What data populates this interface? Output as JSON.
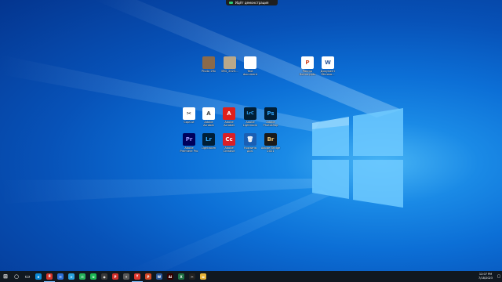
{
  "share_bar": {
    "text": "Идёт демонстрация"
  },
  "desktop_icons": [
    {
      "label": "Photo 2fix",
      "glyph": "",
      "bg": "#8a6a4a",
      "fg": "#fff"
    },
    {
      "label": "IMG_2023...",
      "glyph": "",
      "bg": "#b9a88a",
      "fg": "#fff"
    },
    {
      "label": "Text\ndocument",
      "glyph": "",
      "bg": "#ffffff",
      "fg": "#c00"
    },
    {
      "label": "Ponmo\nHolmo.pptx",
      "glyph": "P",
      "bg": "#ffffff",
      "fg": "#d24726"
    },
    {
      "label": "Документ\nMicroso...",
      "glyph": "W",
      "bg": "#ffffff",
      "fg": "#2b579a"
    },
    {
      "label": "CapCut",
      "glyph": "✂",
      "bg": "#ffffff",
      "fg": "#000"
    },
    {
      "label": "Adobe\nAcrobat",
      "glyph": "A",
      "bg": "#ffffff",
      "fg": "#444"
    },
    {
      "label": "Adobe\nAcrobat",
      "glyph": "A",
      "bg": "#e0201b",
      "fg": "#fff"
    },
    {
      "label": "Adobe\nLightroom",
      "glyph": "LrC",
      "bg": "#001e36",
      "fg": "#31a8ff"
    },
    {
      "label": "Adobe\nPhotoshop",
      "glyph": "Ps",
      "bg": "#001e36",
      "fg": "#31a8ff"
    },
    {
      "label": "Adobe\nPremiere Pro",
      "glyph": "Pr",
      "bg": "#00005b",
      "fg": "#9999ff"
    },
    {
      "label": "Lightroom",
      "glyph": "Lr",
      "bg": "#001e36",
      "fg": "#31a8ff"
    },
    {
      "label": "Adobe\nCreative",
      "glyph": "Cc",
      "bg": "#da1f26",
      "fg": "#fff"
    },
    {
      "label": "Корзина\nдоп.",
      "glyph": "🗑",
      "bg": "#1a5fb4",
      "fg": "#fff"
    },
    {
      "label": "Adobe Bridge\n2021",
      "glyph": "Br",
      "bg": "#1a1a1a",
      "fg": "#e8c57a"
    }
  ],
  "taskbar": {
    "items": [
      {
        "name": "start-button",
        "glyph": "⊞",
        "bg": "transparent",
        "active": false
      },
      {
        "name": "search-button",
        "glyph": "○",
        "bg": "transparent",
        "active": false
      },
      {
        "name": "task-view-button",
        "glyph": "▭",
        "bg": "transparent",
        "active": false
      },
      {
        "name": "edge-app",
        "glyph": "e",
        "bg": "#0c8ad6",
        "active": false
      },
      {
        "name": "yandex-app",
        "glyph": "Я",
        "bg": "#d6342b",
        "active": true
      },
      {
        "name": "mail-app",
        "glyph": "✉",
        "bg": "#2b6fd6",
        "active": false
      },
      {
        "name": "telegram-app",
        "glyph": "➤",
        "bg": "#2aa3de",
        "active": false
      },
      {
        "name": "whatsapp-app",
        "glyph": "✆",
        "bg": "#25b35b",
        "active": false
      },
      {
        "name": "spotify-app",
        "glyph": "≋",
        "bg": "#1db954",
        "active": false
      },
      {
        "name": "obs-app",
        "glyph": "◉",
        "bg": "#3a3a3a",
        "active": false
      },
      {
        "name": "pdf-app",
        "glyph": "P",
        "bg": "#d2302b",
        "active": false
      },
      {
        "name": "settings-app",
        "glyph": "✦",
        "bg": "#5a5a5a",
        "active": false
      },
      {
        "name": "yandex-browser-app",
        "glyph": "Y",
        "bg": "#e0362c",
        "active": true
      },
      {
        "name": "powerpoint-app",
        "glyph": "P",
        "bg": "#d24726",
        "active": false
      },
      {
        "name": "word-app",
        "glyph": "W",
        "bg": "#2b579a",
        "active": false
      },
      {
        "name": "illustrator-app",
        "glyph": "Ai",
        "bg": "#330000",
        "active": false
      },
      {
        "name": "excel-app",
        "glyph": "X",
        "bg": "#1e7145",
        "active": false
      },
      {
        "name": "capcut-app",
        "glyph": "✂",
        "bg": "#222222",
        "active": false
      },
      {
        "name": "file-explorer-app",
        "glyph": "▬",
        "bg": "#e8b53a",
        "active": false
      }
    ],
    "clock": {
      "time": "12:07 PM",
      "date": "7/18/2023"
    }
  }
}
